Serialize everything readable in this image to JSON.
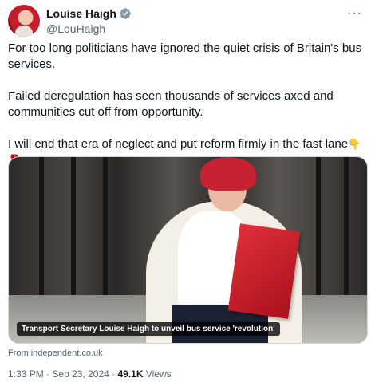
{
  "author": {
    "display_name": "Louise Haigh",
    "handle": "@LouHaigh",
    "verified": true,
    "verified_color": "#829aab"
  },
  "more_glyph": "···",
  "text": {
    "p1": "For too long politicians have ignored the quiet crisis of Britain's bus services.",
    "p2": "Failed deregulation has seen thousands of services axed and communities cut off from opportunity.",
    "p3": "I will end that era of neglect and put reform firmly in the fast lane",
    "emoji_1": "👇",
    "emoji_2": "🌹"
  },
  "media": {
    "caption": "Transport Secretary Louise Haigh to unveil bus service 'revolution'"
  },
  "link_source": "From independent.co.uk",
  "meta": {
    "time": "1:33 PM",
    "separator": "·",
    "date": "Sep 23, 2024",
    "views_count": "49.1K",
    "views_label": "Views"
  }
}
